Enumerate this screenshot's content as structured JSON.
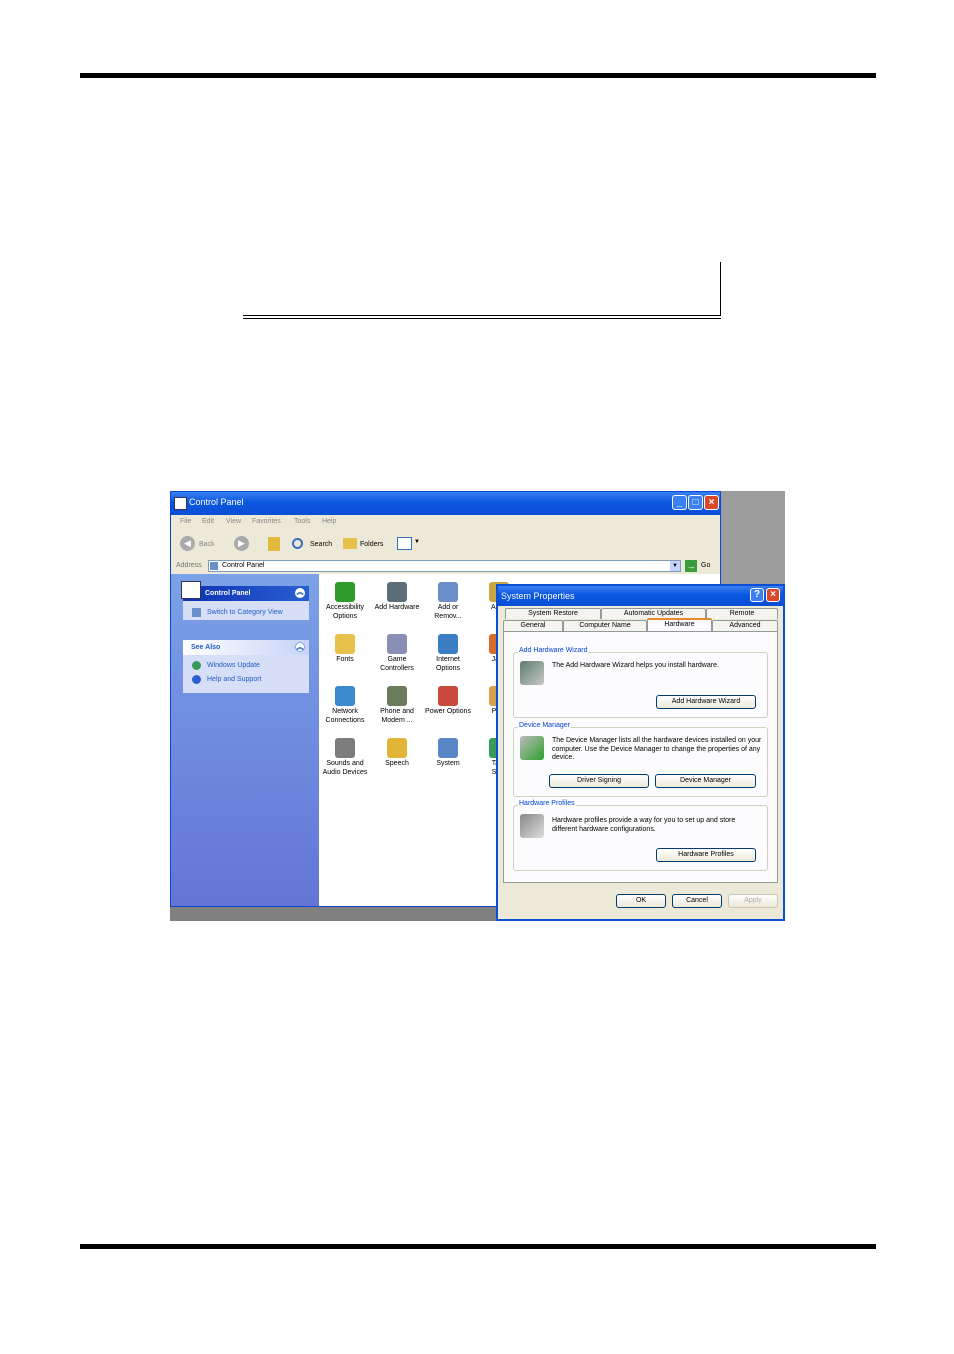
{
  "control_panel": {
    "title": "Control Panel",
    "menu": [
      "File",
      "Edit",
      "View",
      "Favorites",
      "Tools",
      "Help"
    ],
    "toolbar": {
      "back": "Back",
      "search": "Search",
      "folders": "Folders"
    },
    "address": {
      "label": "Address",
      "value": "Control Panel",
      "go": "Go"
    },
    "sidebar": {
      "panel_title": "Control Panel",
      "switch_link": "Switch to Category View",
      "see_also_title": "See Also",
      "see_also_links": [
        "Windows Update",
        "Help and Support"
      ]
    },
    "icons": [
      {
        "line1": "Accessibility",
        "line2": "Options",
        "color": "#2e9b2e"
      },
      {
        "line1": "Add Hardware",
        "line2": "",
        "color": "#5b6e7a"
      },
      {
        "line1": "Add or",
        "line2": "Remov...",
        "color": "#6c8fc9"
      },
      {
        "line1": "Admi",
        "line2": "T",
        "color": "#c9a640"
      },
      {
        "line1": "Fonts",
        "line2": "",
        "color": "#e6c24a"
      },
      {
        "line1": "Game",
        "line2": "Controllers",
        "color": "#8a8fb5"
      },
      {
        "line1": "Internet",
        "line2": "Options",
        "color": "#3a7fc4"
      },
      {
        "line1": "Java",
        "line2": "",
        "color": "#d96a2a"
      },
      {
        "line1": "Network",
        "line2": "Connections",
        "color": "#3b8ad0"
      },
      {
        "line1": "Phone and",
        "line2": "Modem ...",
        "color": "#6a7b5e"
      },
      {
        "line1": "Power Options",
        "line2": "",
        "color": "#c94a3a"
      },
      {
        "line1": "Print",
        "line2": "F",
        "color": "#d9a24a"
      },
      {
        "line1": "Sounds and",
        "line2": "Audio Devices",
        "color": "#7d7d7d"
      },
      {
        "line1": "Speech",
        "line2": "",
        "color": "#e2b437"
      },
      {
        "line1": "System",
        "line2": "",
        "color": "#5a86c7"
      },
      {
        "line1": "Task",
        "line2": "Stan",
        "color": "#3a9a5a"
      }
    ]
  },
  "system_properties": {
    "title": "System Properties",
    "tabs_row1": [
      "System Restore",
      "Automatic Updates",
      "Remote"
    ],
    "tabs_row2": [
      "General",
      "Computer Name",
      "Hardware",
      "Advanced"
    ],
    "add_hardware": {
      "label": "Add Hardware Wizard",
      "text": "The Add Hardware Wizard helps you install hardware.",
      "button": "Add Hardware Wizard"
    },
    "device_manager": {
      "label": "Device Manager",
      "text": "The Device Manager lists all the hardware devices installed on your computer. Use the Device Manager to change the properties of any device.",
      "driver_button": "Driver Signing",
      "dm_button": "Device Manager"
    },
    "hardware_profiles": {
      "label": "Hardware Profiles",
      "text": "Hardware profiles provide a way for you to set up and store different hardware configurations.",
      "button": "Hardware Profiles"
    },
    "ok": "OK",
    "cancel": "Cancel",
    "apply": "Apply"
  }
}
